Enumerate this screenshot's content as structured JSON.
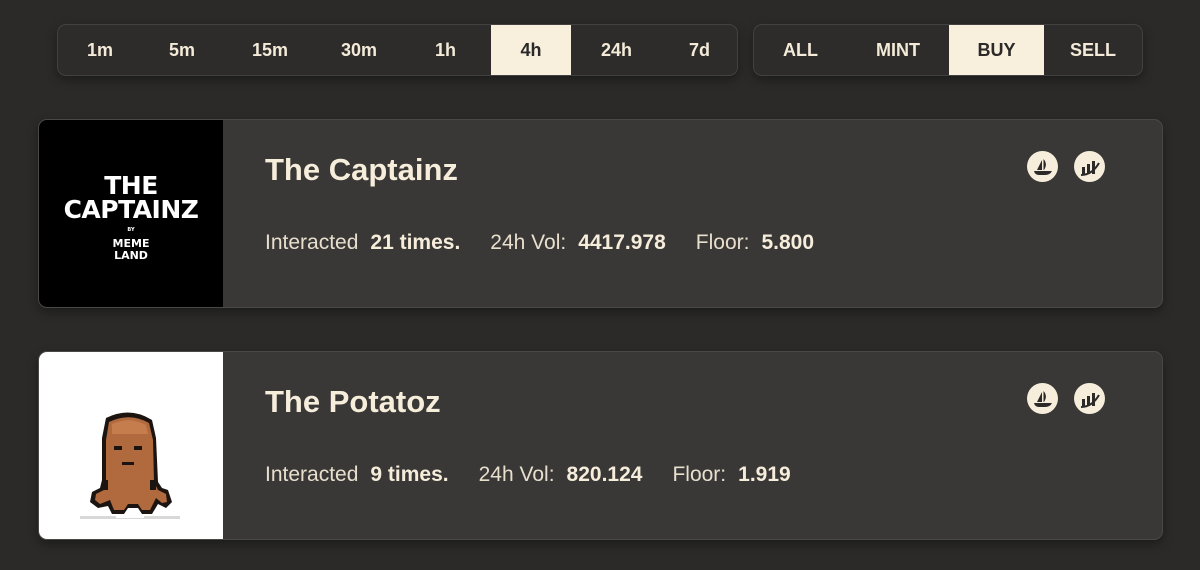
{
  "time_filters": [
    {
      "label": "1m",
      "active": false
    },
    {
      "label": "5m",
      "active": false
    },
    {
      "label": "15m",
      "active": false
    },
    {
      "label": "30m",
      "active": false
    },
    {
      "label": "1h",
      "active": false
    },
    {
      "label": "4h",
      "active": true
    },
    {
      "label": "24h",
      "active": false
    },
    {
      "label": "7d",
      "active": false
    }
  ],
  "type_filters": [
    {
      "label": "ALL",
      "active": false
    },
    {
      "label": "MINT",
      "active": false
    },
    {
      "label": "BUY",
      "active": true
    },
    {
      "label": "SELL",
      "active": false
    }
  ],
  "collections": [
    {
      "name": "The Captainz",
      "logo": {
        "line1": "THE",
        "line2": "CAPTAINZ",
        "by": "BY",
        "meme1": "MEME",
        "meme2": "LAND"
      },
      "interacted_label": "Interacted",
      "interacted_value": "21 times.",
      "vol_label": "24h Vol:",
      "vol_value": "4417.978",
      "floor_label": "Floor:",
      "floor_value": "5.800",
      "icons": [
        "opensea-icon",
        "chart-icon"
      ]
    },
    {
      "name": "The Potatoz",
      "interacted_label": "Interacted",
      "interacted_value": "9 times.",
      "vol_label": "24h Vol:",
      "vol_value": "820.124",
      "floor_label": "Floor:",
      "floor_value": "1.919",
      "icons": [
        "opensea-icon",
        "chart-icon"
      ]
    }
  ],
  "colors": {
    "background": "#2b2a29",
    "card": "#393837",
    "accent": "#f8efdd",
    "text": "#f3ead8"
  }
}
